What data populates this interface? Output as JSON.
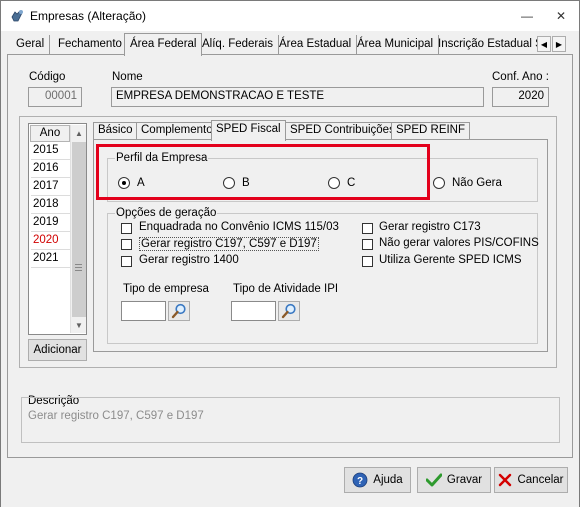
{
  "window": {
    "title": "Empresas (Alteração)",
    "minimize_glyph": "—",
    "close_glyph": "✕",
    "icon": "app-hand-icon"
  },
  "main_tabs": [
    "Geral",
    "Fechamento",
    "Área Federal",
    "Alíq. Federais",
    "Área Estadual",
    "Área Municipal",
    "Inscrição Estadual S"
  ],
  "main_tab_active": "Área Federal",
  "tab_scroll": {
    "left": "◀",
    "right": "▶"
  },
  "company": {
    "codigo_label": "Código",
    "codigo_value": "00001",
    "nome_label": "Nome",
    "nome_value": "EMPRESA DEMONSTRACAO E TESTE",
    "conf_ano_label": "Conf. Ano :",
    "conf_ano_value": "2020"
  },
  "years": {
    "header": "Ano",
    "items": [
      "2015",
      "2016",
      "2017",
      "2018",
      "2019",
      "2020",
      "2021"
    ],
    "selected": "2020",
    "add_button": "Adicionar"
  },
  "sub_tabs": [
    "Básico",
    "Complemento",
    "SPED Fiscal",
    "SPED Contribuições",
    "SPED REINF"
  ],
  "sub_tab_active": "SPED Fiscal",
  "perfil": {
    "title": "Perfil da Empresa",
    "options": [
      "A",
      "B",
      "C",
      "Não Gera"
    ],
    "selected": "A"
  },
  "opcoes": {
    "title": "Opções de geração",
    "left": [
      "Enquadrada no Convênio ICMS 115/03",
      "Gerar registro C197, C597 e D197",
      "Gerar registro 1400"
    ],
    "right": [
      "Gerar registro C173",
      "Não gerar valores PIS/COFINS",
      "Utiliza Gerente SPED ICMS"
    ],
    "tipo_empresa_label": "Tipo de empresa",
    "tipo_atividade_label": "Tipo de Atividade IPI"
  },
  "descricao": {
    "label": "Descrição",
    "text": "Gerar registro C197, C597 e D197"
  },
  "buttons": {
    "ajuda": "Ajuda",
    "gravar": "Gravar",
    "cancelar": "Cancelar"
  },
  "colors": {
    "highlight": "#e3001b",
    "selected_year": "#d10000",
    "gravar_check": "#2e9a2e",
    "cancelar_x": "#d40000"
  }
}
